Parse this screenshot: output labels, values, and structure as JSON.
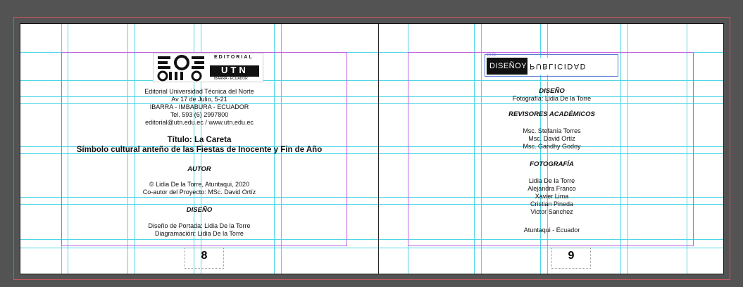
{
  "left_page": {
    "publisher_logo": {
      "text_top": "EDITORIAL",
      "text_main": "UTN",
      "text_sub": "IBARRA - ECUADOR"
    },
    "publisher_lines": [
      "Editorial Universidad Técnica del Norte",
      "Av 17 de Julio, 5-21",
      "IBARRA - IMBABURA - ECUADOR",
      "Tel. 593 (6) 2997800",
      "editorial@utn.edu.ec / www.utn.edu.ec"
    ],
    "title_line1": "Título: La Careta",
    "title_line2": "Símbolo cultural anteño de las Fiestas de Inocente y Fin de Año",
    "author_heading": "AUTOR",
    "author_lines": [
      "© Lidia De la Torre, Atuntaqui, 2020",
      "Co-autor del Proyecto: MSc. David Ortíz"
    ],
    "design_heading": "DISEÑO",
    "design_lines": [
      "Diseño de Portada: Lidia De la Torre",
      "Diagramación: Lidia De la Torre"
    ],
    "page_number": "8"
  },
  "right_page": {
    "ad_logo": {
      "left_text": "DISEÑOY",
      "right_text": "PUBLICIDAD"
    },
    "design_heading": "DISEÑO",
    "design_line": "Fotografía: Lidia De la Torre",
    "reviewers_heading": "REVISORES ACADÉMICOS",
    "reviewers": [
      "Msc. Stefanía Torres",
      "Msc. David Ortíz",
      "Msc. Gandhy Godoy"
    ],
    "photo_heading": "FOTOGRAFÍA",
    "photographers": [
      "Lidia De la Torre",
      "Alejandra Franco",
      "Xavier Lima",
      "Cristian Pineda",
      "Victor Sanchez"
    ],
    "location": "Atuntaqui - Ecuador",
    "page_number": "9"
  },
  "colors": {
    "pasteboard": "#535353",
    "guide_cyan": "#4fd6e6",
    "margin_magenta": "#c061df",
    "bleed_red": "#c8565f"
  }
}
